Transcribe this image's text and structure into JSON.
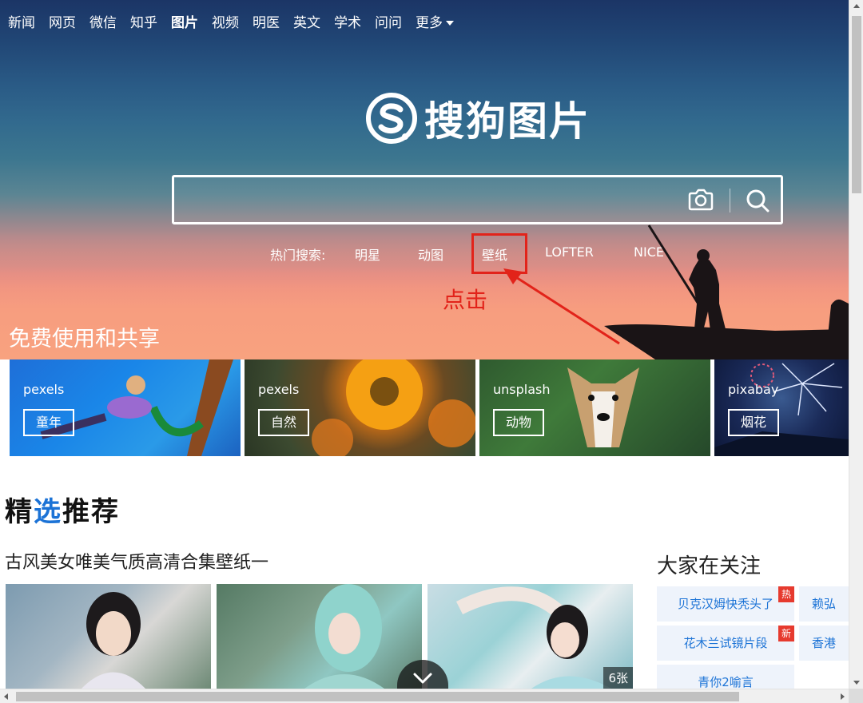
{
  "nav": {
    "items": [
      {
        "label": "新闻",
        "active": false
      },
      {
        "label": "网页",
        "active": false
      },
      {
        "label": "微信",
        "active": false
      },
      {
        "label": "知乎",
        "active": false
      },
      {
        "label": "图片",
        "active": true
      },
      {
        "label": "视频",
        "active": false
      },
      {
        "label": "明医",
        "active": false
      },
      {
        "label": "英文",
        "active": false
      },
      {
        "label": "学术",
        "active": false
      },
      {
        "label": "问问",
        "active": false
      }
    ],
    "more_label": "更多"
  },
  "logo": {
    "text": "搜狗图片"
  },
  "search": {
    "value": "",
    "placeholder": ""
  },
  "hot_search": {
    "label": "热门搜索:",
    "items": [
      "明星",
      "动图",
      "壁纸",
      "LOFTER",
      "NICE"
    ]
  },
  "annotation": {
    "text": "点击",
    "color": "#e2231a"
  },
  "free_section": {
    "title": "免费使用和共享",
    "cards": [
      {
        "source": "pexels",
        "tag": "童年"
      },
      {
        "source": "pexels",
        "tag": "自然"
      },
      {
        "source": "unsplash",
        "tag": "动物"
      },
      {
        "source": "pixabay",
        "tag": "烟花"
      }
    ]
  },
  "featured": {
    "title_prefix": "精",
    "title_highlight": "选",
    "title_suffix": "推荐",
    "album_title": "古风美女唯美气质高清合集壁纸一",
    "image_count": "6张"
  },
  "follow": {
    "title": "大家在关注",
    "items": [
      {
        "label": "贝克汉姆快秃头了",
        "badge": "热"
      },
      {
        "label": "赖弘",
        "badge": ""
      },
      {
        "label": "花木兰试镜片段",
        "badge": "新"
      },
      {
        "label": "香港",
        "badge": ""
      },
      {
        "label": "青你2喻言",
        "badge": ""
      }
    ]
  },
  "colors": {
    "accent": "#1c73d6",
    "badge": "#e63a2e"
  }
}
